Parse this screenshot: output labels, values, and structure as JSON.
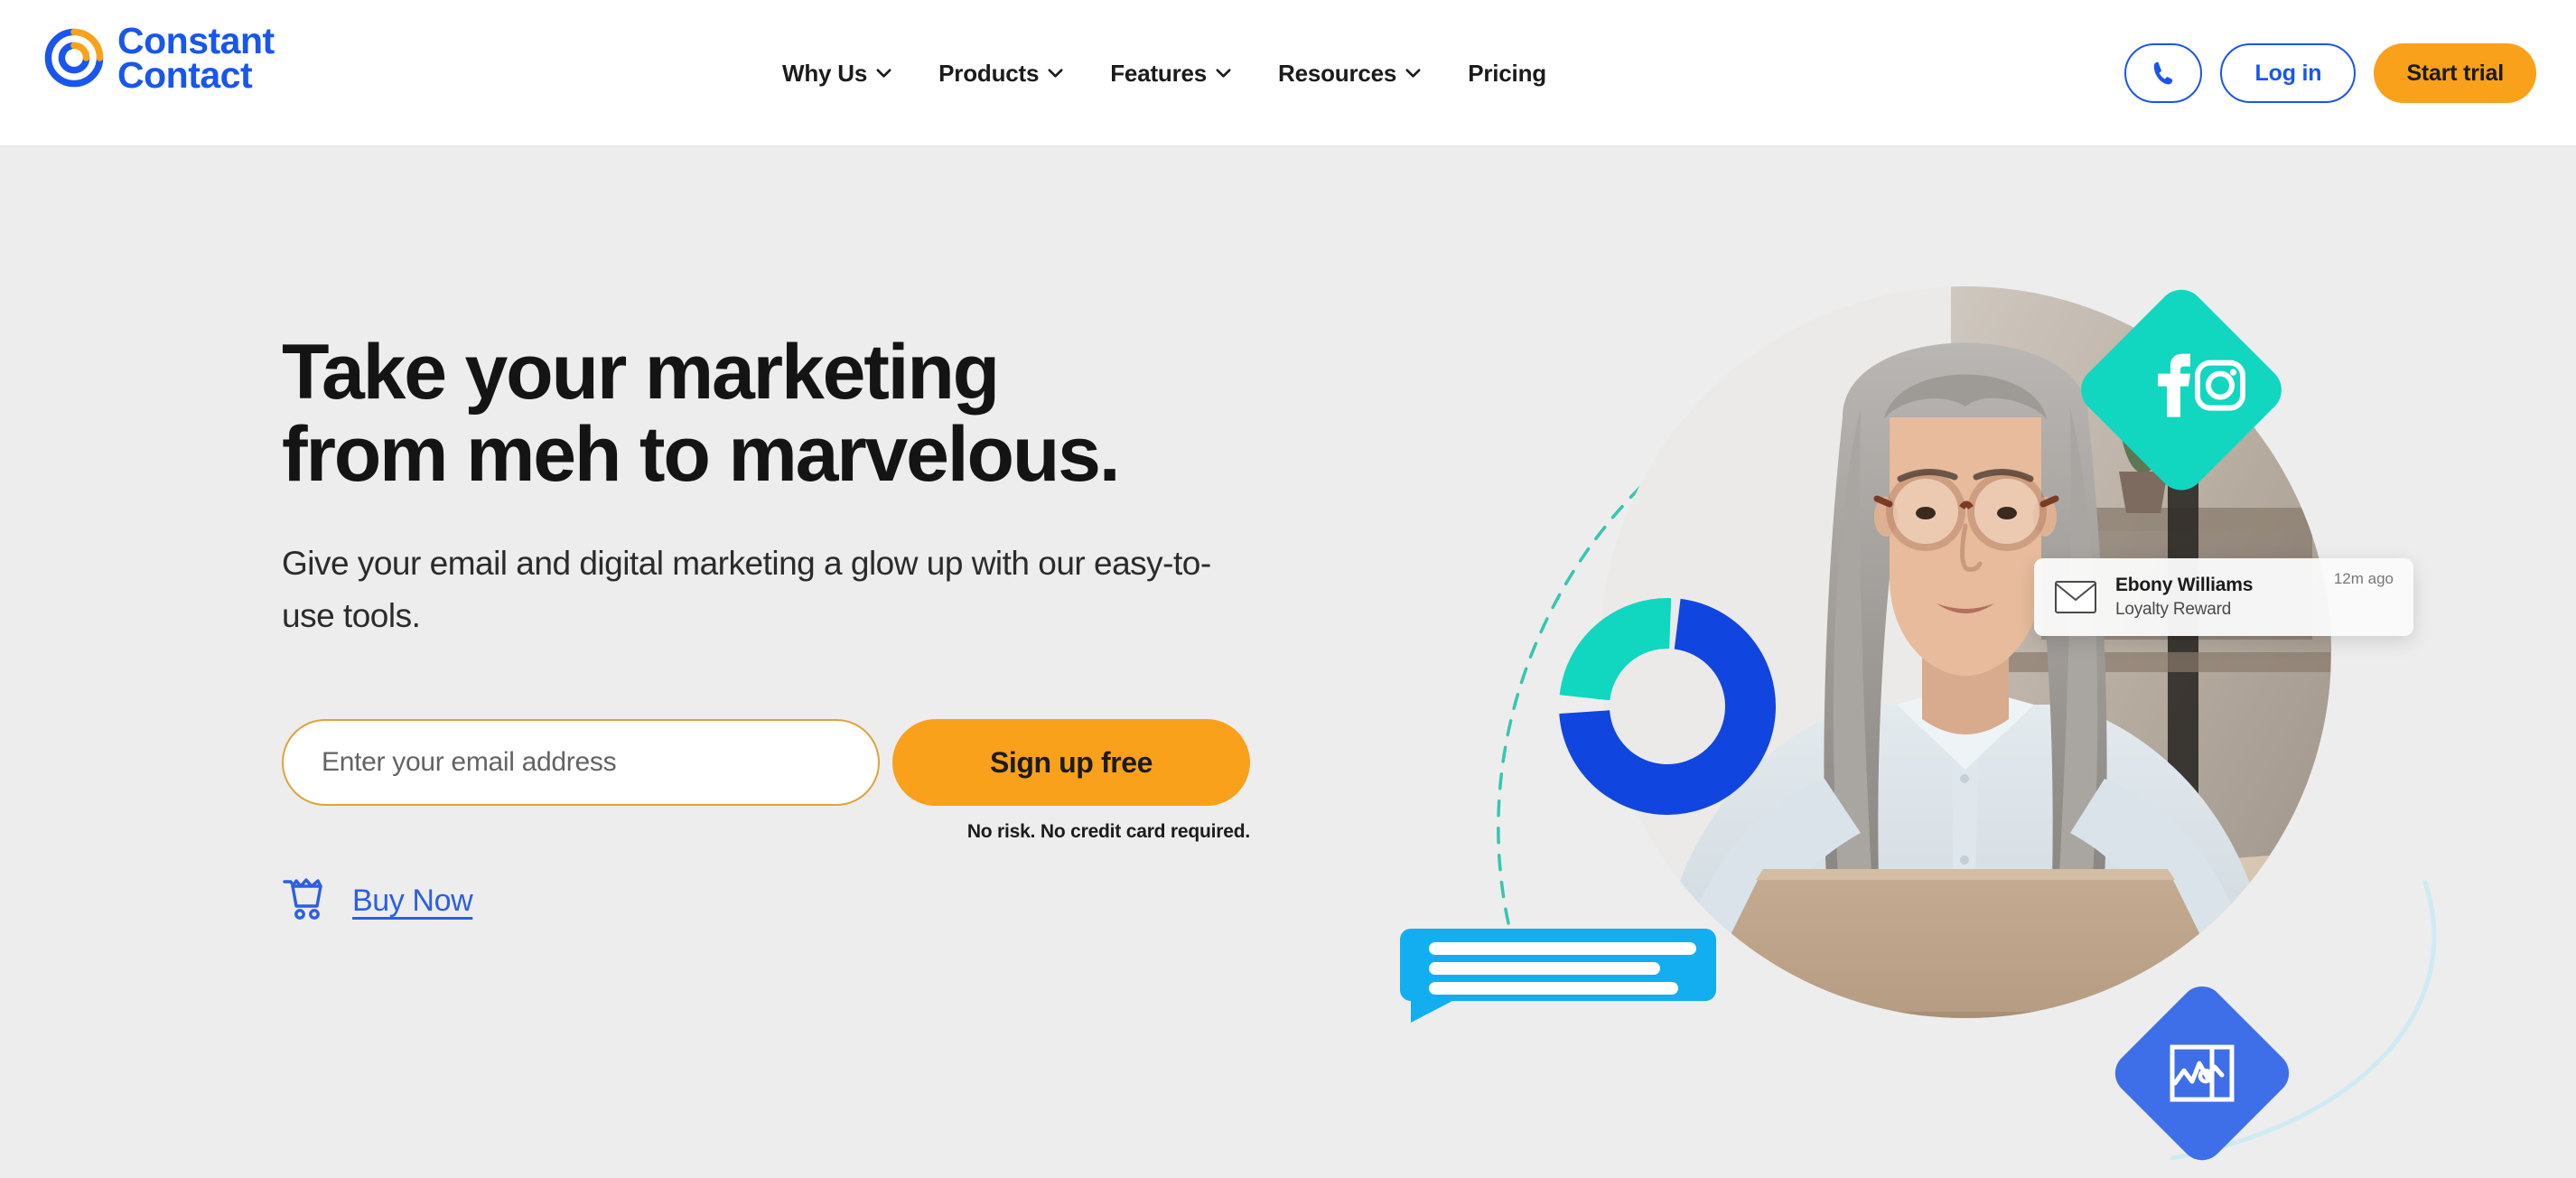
{
  "brand": {
    "name": "Constant Contact",
    "name_line1": "Constant",
    "name_line2": "Contact",
    "logo_blue": "#1856ED",
    "logo_orange": "#F9A11B",
    "accent_orange": "#F9A11B",
    "link_blue": "#2B5FE3",
    "teal": "#11D6C0",
    "page_background": "#EDEDED"
  },
  "header": {
    "nav": [
      {
        "label": "Why Us",
        "has_dropdown": true,
        "icon": "chevron-down-icon"
      },
      {
        "label": "Products",
        "has_dropdown": true,
        "icon": "chevron-down-icon"
      },
      {
        "label": "Features",
        "has_dropdown": true,
        "icon": "chevron-down-icon"
      },
      {
        "label": "Resources",
        "has_dropdown": true,
        "icon": "chevron-down-icon"
      },
      {
        "label": "Pricing",
        "has_dropdown": false,
        "icon": ""
      }
    ],
    "phone_button": {
      "icon": "phone-icon",
      "label": ""
    },
    "login_button": {
      "label": "Log in"
    },
    "trial_button": {
      "label": "Start trial"
    }
  },
  "hero": {
    "headline_line1": "Take your marketing",
    "headline_line2": "from meh to marvelous.",
    "subhead_line1": "Give your email and digital marketing a glow up",
    "subhead_line2": "with our easy-to-use tools.",
    "email_placeholder": "Enter your email address",
    "email_value": "",
    "signup_button": "Sign up free",
    "disclaimer": "No risk. No credit card required.",
    "buy_now": {
      "label": "Buy Now",
      "icon": "shopping-cart-icon"
    }
  },
  "hero_art": {
    "image_description": "Woman with long grey hair and glasses working at a laptop",
    "donut": {
      "segments": [
        {
          "name": "primary",
          "color": "#1145E0",
          "percent": 72
        },
        {
          "name": "secondary",
          "color": "#11D6C0",
          "percent": 28
        }
      ]
    },
    "social_badge": {
      "shape": "rotated-square",
      "color": "#11D6C0",
      "icons": [
        "facebook-icon",
        "instagram-icon"
      ]
    },
    "analytics_badge": {
      "shape": "rotated-square",
      "color": "#3E6FE8",
      "icon": "analytics-chart-icon"
    },
    "message_bubble": {
      "color": "#12AEF0",
      "lines": 3
    },
    "notification": {
      "icon": "envelope-icon",
      "name": "Ebony Williams",
      "subject": "Loyalty Reward",
      "time": "12m ago"
    }
  }
}
